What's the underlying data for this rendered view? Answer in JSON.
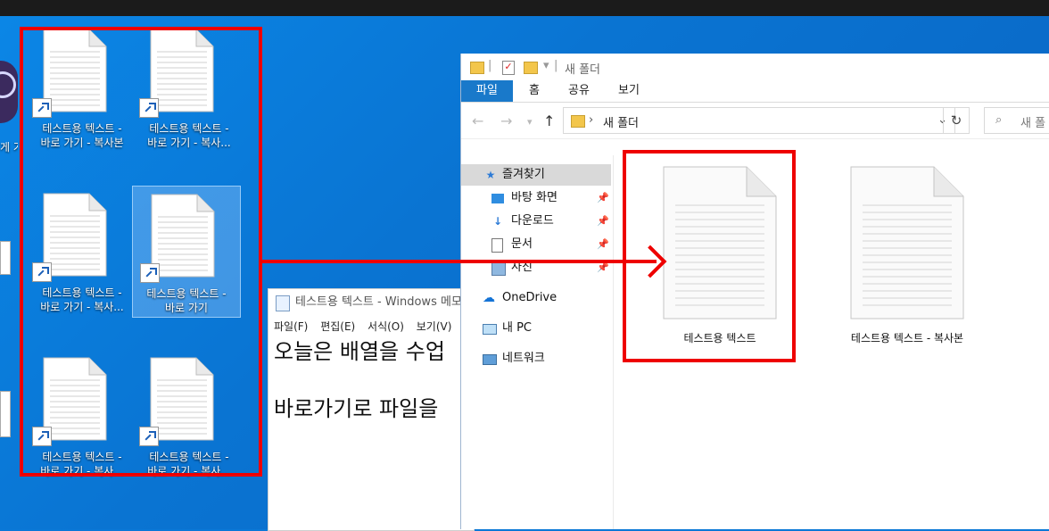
{
  "desktop": {
    "left_partial_label": "게 가기",
    "icons": [
      {
        "label_line1": "테스트용 텍스트 -",
        "label_line2": "바로 가기 - 복사본"
      },
      {
        "label_line1": "테스트용 텍스트 -",
        "label_line2": "바로 가기 - 복사..."
      },
      {
        "label_line1": "테스트용 텍스트 -",
        "label_line2": "바로 가기 - 복사..."
      },
      {
        "label_line1": "테스트용 텍스트 -",
        "label_line2": "바로 가기"
      },
      {
        "label_line1": "테스트용 텍스트 -",
        "label_line2": "바로 가기 - 복사..."
      },
      {
        "label_line1": "테스트용 텍스트 -",
        "label_line2": "바로 가기 - 복사..."
      }
    ]
  },
  "notepad": {
    "title": "테스트용 텍스트 - Windows 메모장",
    "menu": [
      "파일(F)",
      "편집(E)",
      "서식(O)",
      "보기(V)"
    ],
    "lines": [
      "오늘은 배열을 수업",
      "",
      "바로가기로 파일을"
    ]
  },
  "explorer": {
    "window_title": "새 폴더",
    "ribbon_tabs": [
      "파일",
      "홈",
      "공유",
      "보기"
    ],
    "address_path": "새 폴더",
    "search_placeholder": "새 폴",
    "nav": {
      "quick_access": "즐겨찾기",
      "desktop": "바탕 화면",
      "downloads": "다운로드",
      "documents": "문서",
      "pictures": "사진",
      "onedrive": "OneDrive",
      "this_pc": "내 PC",
      "network": "네트워크"
    },
    "files": [
      {
        "name": "테스트용 텍스트"
      },
      {
        "name": "테스트용 텍스트 - 복사본"
      }
    ]
  },
  "colors": {
    "annotation_red": "#ee0000",
    "ribbon_active": "#1979ca"
  }
}
